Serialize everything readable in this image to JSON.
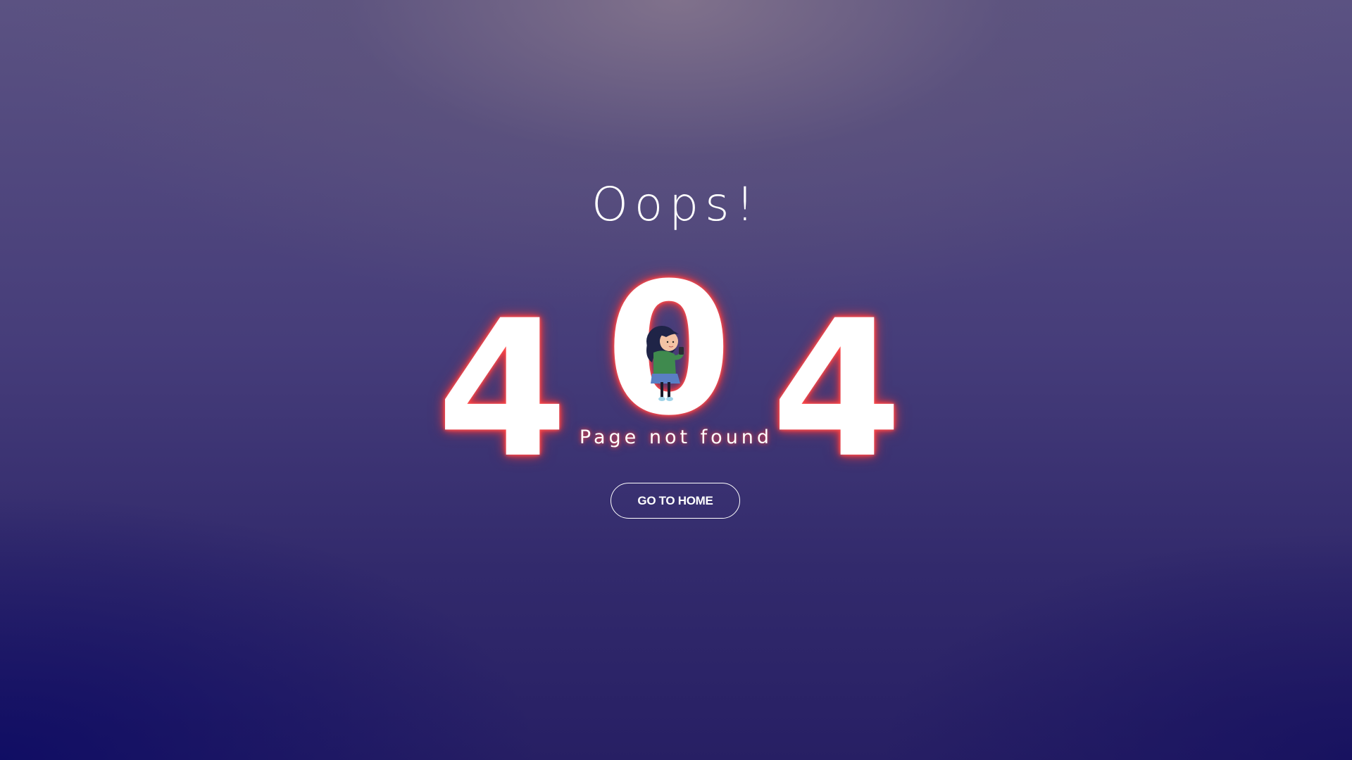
{
  "page": {
    "heading": "Oops!",
    "error_code": {
      "first_digit": "4",
      "middle_digit": "0",
      "last_digit": "4"
    },
    "subtitle": "Page not found",
    "home_button_label": "GO TO HOME"
  },
  "colors": {
    "background_top": "#7b6f8c",
    "background_bottom": "#1a1464",
    "glow": "#ff3b3b",
    "text": "#ffffff"
  },
  "icons": {
    "illustration": "girl-with-phone-illustration"
  }
}
